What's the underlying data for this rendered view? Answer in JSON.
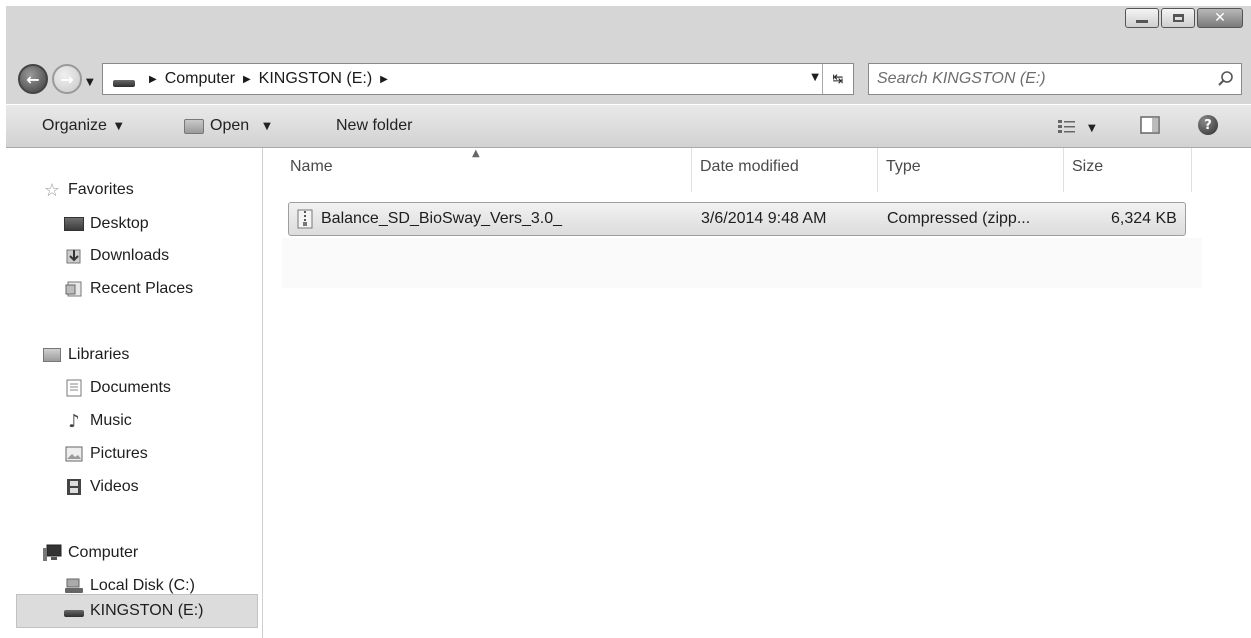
{
  "address_bar": {
    "crumbs": [
      "Computer",
      "KINGSTON (E:)"
    ]
  },
  "search": {
    "placeholder": "Search KINGSTON (E:)"
  },
  "toolbar": {
    "organize": "Organize",
    "open": "Open",
    "new_folder": "New folder"
  },
  "nav": {
    "favorites": "Favorites",
    "desktop": "Desktop",
    "downloads": "Downloads",
    "recent_places": "Recent Places",
    "libraries": "Libraries",
    "documents": "Documents",
    "music": "Music",
    "pictures": "Pictures",
    "videos": "Videos",
    "computer": "Computer",
    "local_disk": "Local Disk (C:)",
    "kingston": "KINGSTON (E:)"
  },
  "columns": {
    "name": "Name",
    "date_modified": "Date modified",
    "type": "Type",
    "size": "Size"
  },
  "files": [
    {
      "name": "Balance_SD_BioSway_Vers_3.0_",
      "date_modified": "3/6/2014 9:48 AM",
      "type": "Compressed (zipp...",
      "size": "6,324 KB"
    }
  ]
}
